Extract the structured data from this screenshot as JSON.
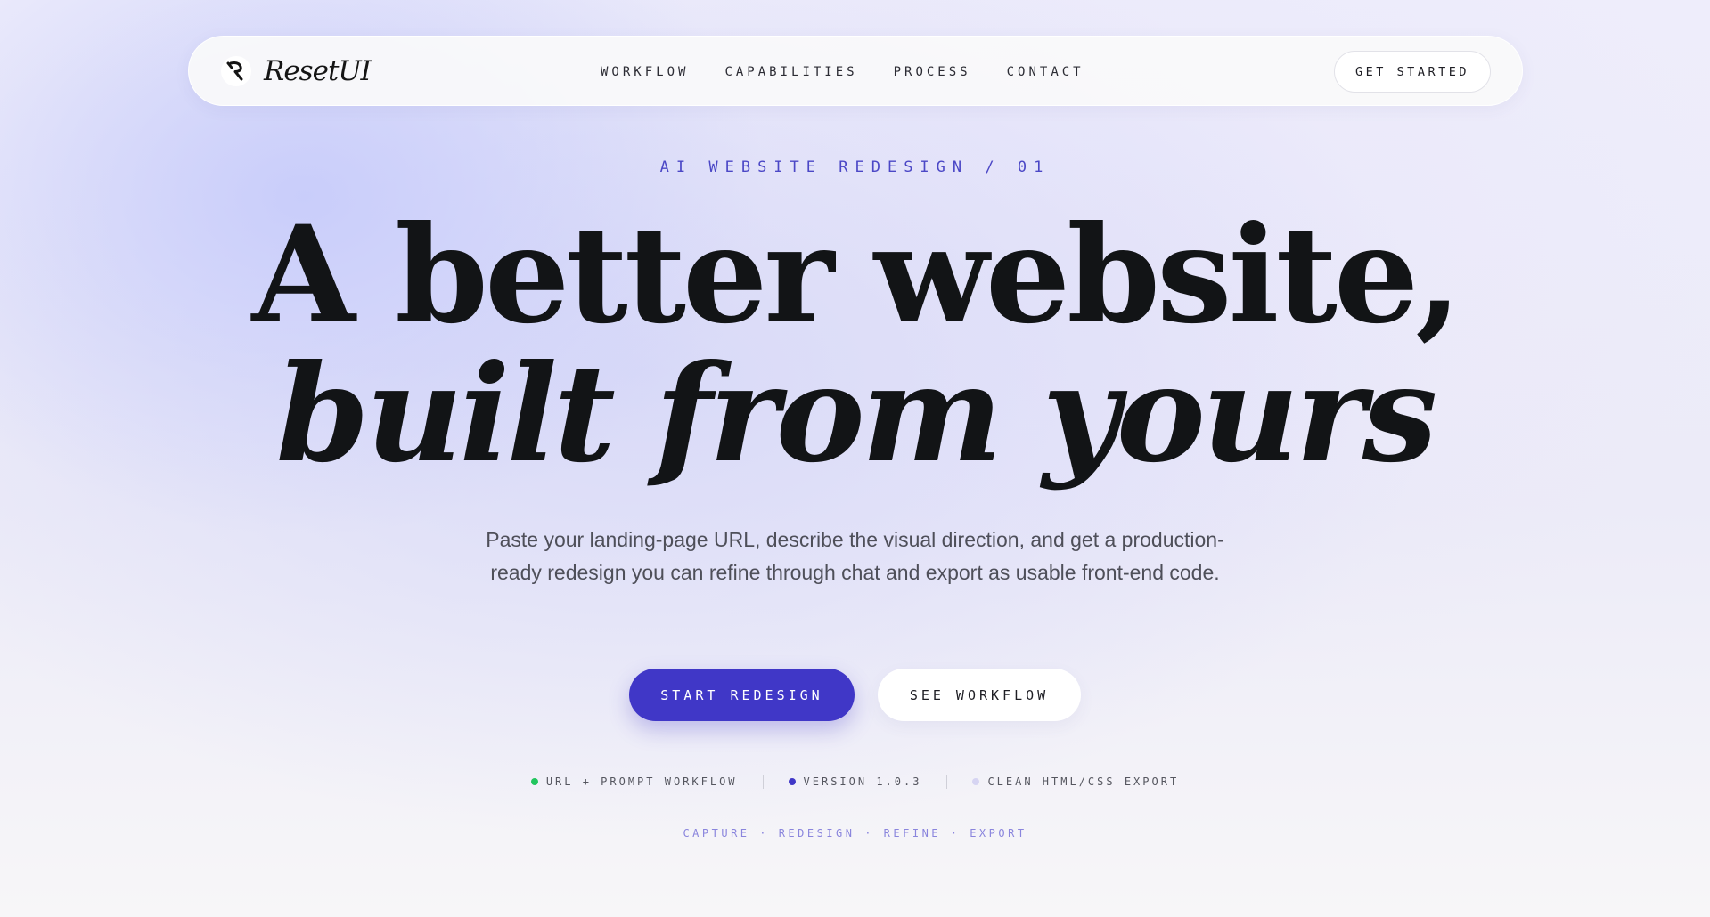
{
  "nav": {
    "brand_name": "ResetUI",
    "links": [
      "WORKFLOW",
      "CAPABILITIES",
      "PROCESS",
      "CONTACT"
    ],
    "cta_label": "GET STARTED"
  },
  "hero": {
    "eyebrow": "AI WEBSITE REDESIGN / 01",
    "headline_line1": "A better website,",
    "headline_line2": "built from yours",
    "subcopy": "Paste your landing-page URL, describe the visual direction, and get a production-ready redesign you can refine through chat and export as usable front-end code.",
    "primary_cta": "START REDESIGN",
    "secondary_cta": "SEE WORKFLOW"
  },
  "meta": [
    {
      "label": "URL + PROMPT WORKFLOW",
      "dot_color": "#22c55e"
    },
    {
      "label": "VERSION 1.0.3",
      "dot_color": "#4037c7"
    },
    {
      "label": "CLEAN HTML/CSS EXPORT",
      "dot_color": "#d6d4f2"
    }
  ],
  "steps_line": "CAPTURE · REDESIGN · REFINE · EXPORT",
  "colors": {
    "accent": "#4037c7",
    "eyebrow": "#4b47c6",
    "steps": "#8a85dd"
  }
}
